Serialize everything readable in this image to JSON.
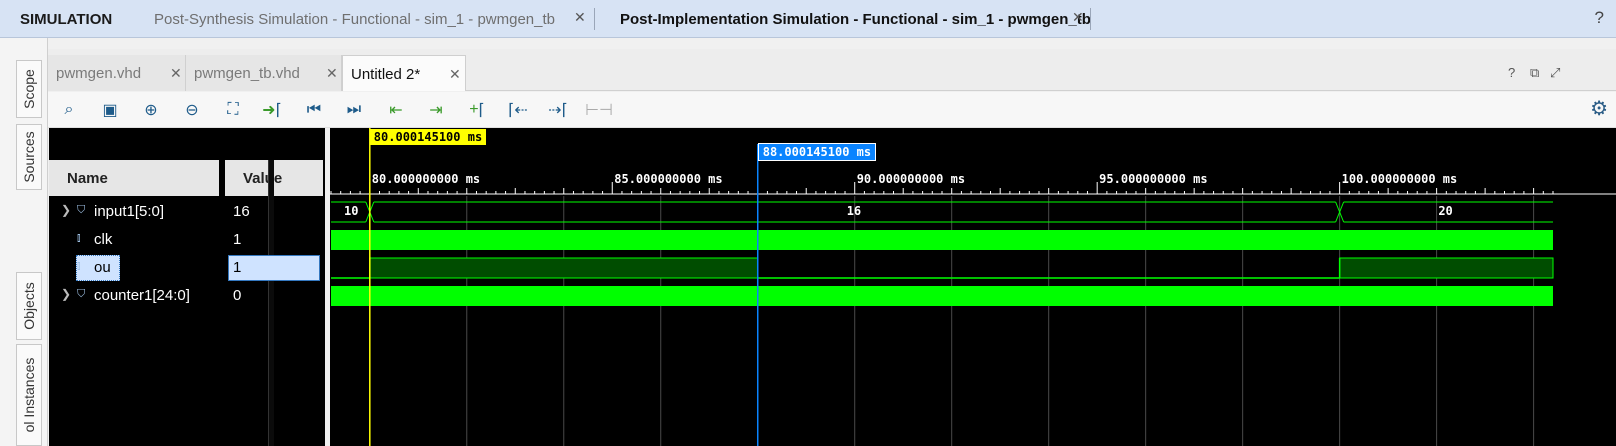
{
  "simulation_bar": {
    "title": "SIMULATION",
    "tabs": [
      {
        "label": "Post-Synthesis Simulation - Functional - sim_1 - pwmgen_tb",
        "active": false
      },
      {
        "label": "Post-Implementation Simulation - Functional - sim_1 - pwmgen_tb",
        "active": true
      }
    ],
    "help_icon": "?"
  },
  "side_tabs": [
    "Scope",
    "Sources",
    "Objects",
    "ol Instances"
  ],
  "editor_tabs": [
    {
      "label": "pwmgen.vhd",
      "active": false
    },
    {
      "label": "pwmgen_tb.vhd",
      "active": false
    },
    {
      "label": "Untitled 2*",
      "active": true
    }
  ],
  "toolbar_icons": [
    "search-icon",
    "save-icon",
    "zoom-in-icon",
    "zoom-out-icon",
    "zoom-fit-icon",
    "go-to-cursor-icon",
    "go-to-time-zero-icon",
    "go-to-last-time-icon",
    "previous-transition-icon",
    "next-transition-icon",
    "add-marker-icon",
    "previous-marker-icon",
    "next-marker-icon",
    "swap-cursors-icon",
    "settings-icon"
  ],
  "columns": {
    "name": "Name",
    "value": "Value"
  },
  "signals": [
    {
      "name": "input1[5:0]",
      "value": "16",
      "type": "bus",
      "selected": false
    },
    {
      "name": "clk",
      "value": "1",
      "type": "bit",
      "selected": false
    },
    {
      "name": "ou",
      "value": "1",
      "type": "bit",
      "selected": true
    },
    {
      "name": "counter1[24:0]",
      "value": "0",
      "type": "bus",
      "selected": false
    }
  ],
  "waveform": {
    "time_unit": "ms",
    "view_start": 79.2,
    "view_end": 104.4,
    "cursor_primary": {
      "time": 80.0001451,
      "label": "80.000145100 ms",
      "color": "#ffff00"
    },
    "cursor_secondary": {
      "time": 88.0001451,
      "label": "88.000145100 ms",
      "color": "#0a84ff"
    },
    "major_ticks": [
      {
        "time": 80,
        "label": "80.000000000 ms"
      },
      {
        "time": 85,
        "label": "85.000000000 ms"
      },
      {
        "time": 90,
        "label": "90.000000000 ms"
      },
      {
        "time": 95,
        "label": "95.000000000 ms"
      },
      {
        "time": 100,
        "label": "100.000000000 ms"
      }
    ],
    "bus_segments": [
      {
        "start": 79.2,
        "end": 80.0,
        "label": "10"
      },
      {
        "start": 80.0,
        "end": 100.0,
        "label": "16"
      },
      {
        "start": 100.0,
        "end": 104.4,
        "label": "20"
      }
    ],
    "ou_transitions": [
      {
        "time": 79.2,
        "level": 0
      },
      {
        "time": 80.0,
        "level": 1
      },
      {
        "time": 88.0,
        "level": 0
      },
      {
        "time": 100.0,
        "level": 1
      }
    ],
    "colors": {
      "signal": "#00ff00",
      "signal_dim": "#004d00",
      "grid": "#4a4a4a",
      "ruler": "#ffffff"
    }
  }
}
